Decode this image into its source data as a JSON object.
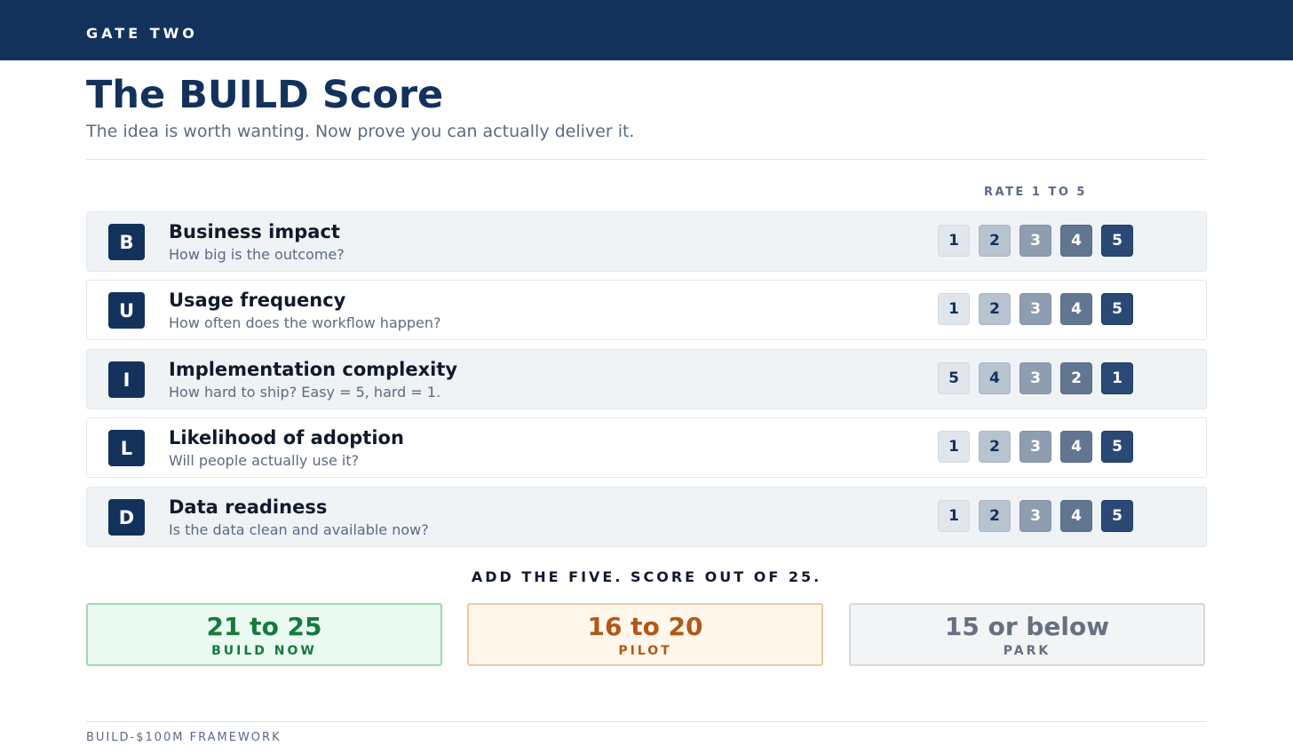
{
  "header": {
    "label": "GATE TWO"
  },
  "title": "The BUILD Score",
  "subtitle": "The idea is worth wanting. Now prove you can actually deliver it.",
  "rate_header": "RATE 1 TO 5",
  "criteria": [
    {
      "letter": "B",
      "title": "Business impact",
      "description": "How big is the outcome?",
      "scale": [
        "1",
        "2",
        "3",
        "4",
        "5"
      ]
    },
    {
      "letter": "U",
      "title": "Usage frequency",
      "description": "How often does the workflow happen?",
      "scale": [
        "1",
        "2",
        "3",
        "4",
        "5"
      ]
    },
    {
      "letter": "I",
      "title": "Implementation complexity",
      "description": "How hard to ship? Easy = 5, hard = 1.",
      "scale": [
        "5",
        "4",
        "3",
        "2",
        "1"
      ]
    },
    {
      "letter": "L",
      "title": "Likelihood of adoption",
      "description": "Will people actually use it?",
      "scale": [
        "1",
        "2",
        "3",
        "4",
        "5"
      ]
    },
    {
      "letter": "D",
      "title": "Data readiness",
      "description": "Is the data clean and available now?",
      "scale": [
        "1",
        "2",
        "3",
        "4",
        "5"
      ]
    }
  ],
  "instruction": "ADD THE FIVE. SCORE OUT OF 25.",
  "results": [
    {
      "range": "21 to 25",
      "label": "BUILD NOW",
      "color": "#147a3d"
    },
    {
      "range": "16 to 20",
      "label": "PILOT",
      "color": "#b35814"
    },
    {
      "range": "15 or below",
      "label": "PARK",
      "color": "#667082"
    }
  ],
  "footer": "BUILD-$100M FRAMEWORK",
  "colors": {
    "brand_navy": "#12325c",
    "row_shade": "#eff3f6"
  }
}
